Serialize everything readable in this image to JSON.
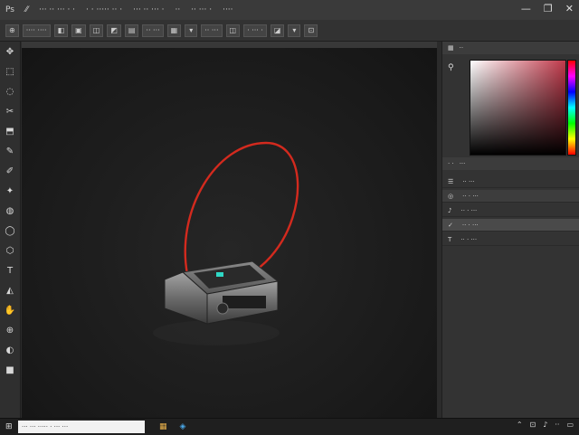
{
  "titlebar": {
    "items": [
      "Ps",
      "⁄⁄",
      "··· ·· ··· · ·",
      "· · ····· ·· ·",
      "··· ·· ··· ·",
      "··",
      "·· ··· ·",
      "····"
    ],
    "controls": [
      "—",
      "❐",
      "✕"
    ]
  },
  "options": {
    "buttons": [
      "⊕",
      "···· ····",
      "◧",
      "▣",
      "◫",
      "◩",
      "▤",
      "·· ···",
      "▦",
      "▾",
      "·· ···",
      "◫",
      "· ··· ·",
      "◪",
      "▾",
      "⊡"
    ]
  },
  "tools": [
    "✥",
    "⬚",
    "◌",
    "✂",
    "⬒",
    "✎",
    "✐",
    "✦",
    "◍",
    "◯",
    "⬡",
    "T",
    "◭",
    "✋",
    "⊕",
    "◐",
    "■"
  ],
  "right_panel": {
    "header_tabs": [
      "▦",
      "··"
    ],
    "swatch_label": "⚲",
    "layers_header": [
      "· ·",
      "···"
    ],
    "layers": [
      {
        "icon": "☰",
        "label": "·· ···"
      },
      {
        "icon": "◎",
        "label": "·· · ···"
      },
      {
        "icon": "♪",
        "label": "·· · ···"
      },
      {
        "icon": "✓",
        "label": "·· · ···"
      },
      {
        "icon": "T",
        "label": "·· · ···"
      }
    ]
  },
  "taskbar": {
    "start": "⊞",
    "search_placeholder": "··· ··· ····· · ··· ···",
    "apps": [
      "▦",
      "◈"
    ],
    "tray": [
      "⌃",
      "⊡",
      "♪",
      "··",
      "▭"
    ]
  },
  "colors": {
    "accent_red": "#d32a1e",
    "teal": "#2fd8c5"
  }
}
